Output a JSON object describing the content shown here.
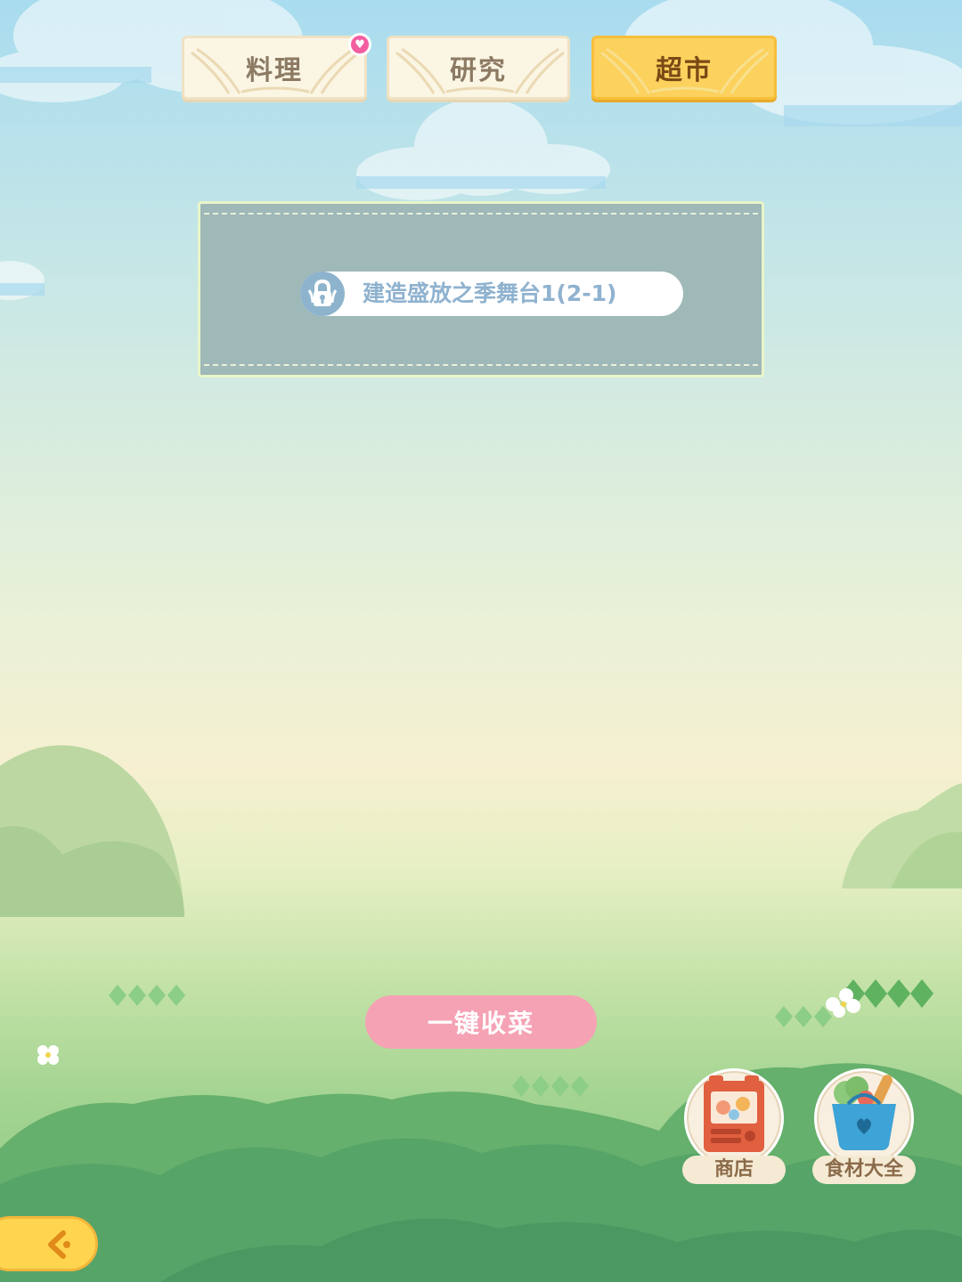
{
  "tabs": [
    {
      "label": "料理",
      "active": false,
      "badge": true
    },
    {
      "label": "研究",
      "active": false,
      "badge": false
    },
    {
      "label": "超市",
      "active": true,
      "badge": false
    }
  ],
  "lock_panel": {
    "requirement": "建造盛放之季舞台1(2-1)",
    "icon": "lock-icon"
  },
  "collect_button": {
    "label": "一键收菜"
  },
  "shop_button": {
    "label": "商店",
    "icon": "vending-machine-icon"
  },
  "ingredients_button": {
    "label": "食材大全",
    "icon": "grocery-basket-icon"
  },
  "back_button": {
    "icon": "back-arrow-icon"
  },
  "colors": {
    "active_tab": "#fcd15d",
    "collect_button": "#f5a2b4",
    "lock_panel": "#9fb8b8"
  }
}
